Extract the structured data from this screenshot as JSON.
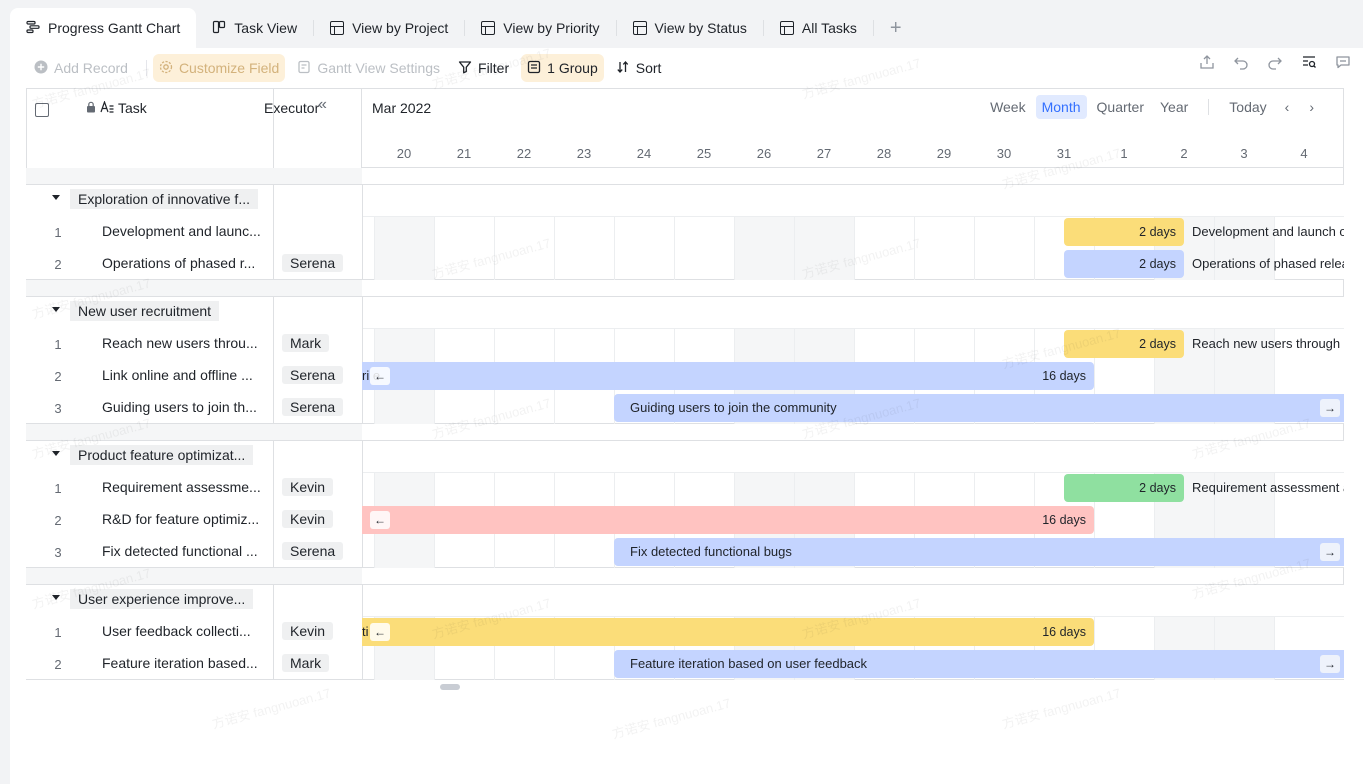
{
  "tabs": [
    {
      "label": "Progress Gantt Chart",
      "icon": "gantt-icon",
      "active": true
    },
    {
      "label": "Task View",
      "icon": "card-icon"
    },
    {
      "label": "View by Project",
      "icon": "table-icon"
    },
    {
      "label": "View by Priority",
      "icon": "table-icon"
    },
    {
      "label": "View by Status",
      "icon": "table-icon"
    },
    {
      "label": "All Tasks",
      "icon": "table-icon"
    }
  ],
  "toolbar": {
    "add_record": "Add Record",
    "customize_field": "Customize Field",
    "gantt_settings": "Gantt View Settings",
    "filter": "Filter",
    "group": "1 Group",
    "sort": "Sort"
  },
  "table_header": {
    "task": "Task",
    "executor": "Executor"
  },
  "gantt_header": {
    "month": "Mar 2022",
    "scales": [
      "Week",
      "Month",
      "Quarter",
      "Year"
    ],
    "active_scale": "Month",
    "today": "Today",
    "days": [
      "20",
      "21",
      "22",
      "23",
      "24",
      "25",
      "26",
      "27",
      "28",
      "29",
      "30",
      "31",
      "1",
      "2",
      "3",
      "4"
    ]
  },
  "groups": [
    {
      "title": "Exploration of innovative f...",
      "rows": [
        {
          "num": "1",
          "task": "Development and launc...",
          "executor": "",
          "bar_label": "Development and launch of inno",
          "duration": "2 days"
        },
        {
          "num": "2",
          "task": "Operations of phased r...",
          "executor": "Serena",
          "bar_label": "Operations of phased release of",
          "duration": "2 days"
        }
      ]
    },
    {
      "title": "New user recruitment",
      "rows": [
        {
          "num": "1",
          "task": "Reach new users throu...",
          "executor": "Mark",
          "bar_label": "Reach new users through multip",
          "duration": "2 days"
        },
        {
          "num": "2",
          "task": "Link online and offline ...",
          "executor": "Serena",
          "bar_label": "ri e",
          "duration": "16 days"
        },
        {
          "num": "3",
          "task": "Guiding users to join th...",
          "executor": "Serena",
          "bar_label": "Guiding users to join the community",
          "duration": ""
        }
      ]
    },
    {
      "title": "Product feature optimizat...",
      "rows": [
        {
          "num": "1",
          "task": "Requirement assessme...",
          "executor": "Kevin",
          "bar_label": "Requirement assessment and ta",
          "duration": "2 days"
        },
        {
          "num": "2",
          "task": "R&D for feature optimiz...",
          "executor": "Kevin",
          "bar_label": "",
          "duration": "16 days"
        },
        {
          "num": "3",
          "task": "Fix detected functional ...",
          "executor": "Serena",
          "bar_label": "Fix detected functional bugs",
          "duration": ""
        }
      ]
    },
    {
      "title": "User experience improve...",
      "rows": [
        {
          "num": "1",
          "task": "User feedback collecti...",
          "executor": "Kevin",
          "bar_label": "ti",
          "duration": "16 days"
        },
        {
          "num": "2",
          "task": "Feature iteration based...",
          "executor": "Mark",
          "bar_label": "Feature iteration based on user feedback",
          "duration": ""
        }
      ]
    }
  ],
  "watermark": "方诺安 fangnuoan.17",
  "colors": {
    "accent": "#3370ff",
    "yellow": "#fbdd79",
    "blue": "#c4d4ff",
    "green": "#8fe0a0",
    "red": "#ffc3c1"
  }
}
